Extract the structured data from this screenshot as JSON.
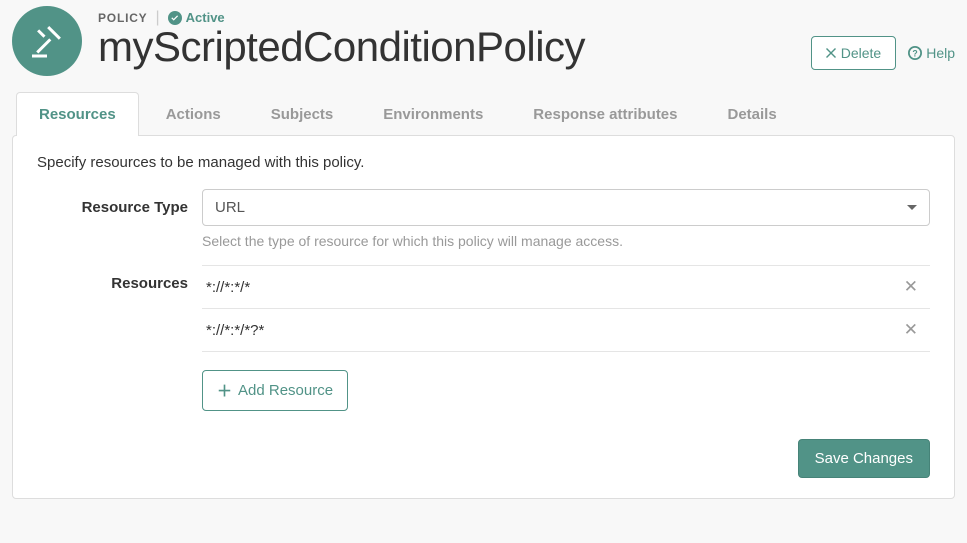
{
  "eyebrow": {
    "label": "POLICY",
    "status_label": "Active"
  },
  "page_title": "myScriptedConditionPolicy",
  "actions": {
    "delete_label": "Delete",
    "help_label": "Help"
  },
  "tabs": [
    {
      "label": "Resources",
      "active": true
    },
    {
      "label": "Actions",
      "active": false
    },
    {
      "label": "Subjects",
      "active": false
    },
    {
      "label": "Environments",
      "active": false
    },
    {
      "label": "Response attributes",
      "active": false
    },
    {
      "label": "Details",
      "active": false
    }
  ],
  "panel": {
    "intro": "Specify resources to be managed with this policy.",
    "resource_type_label": "Resource Type",
    "resource_type_value": "URL",
    "resource_type_help": "Select the type of resource for which this policy will manage access.",
    "resources_label": "Resources",
    "resources": [
      "*://*:*/*",
      "*://*:*/*?*"
    ],
    "add_resource_label": "Add Resource",
    "save_label": "Save Changes"
  }
}
